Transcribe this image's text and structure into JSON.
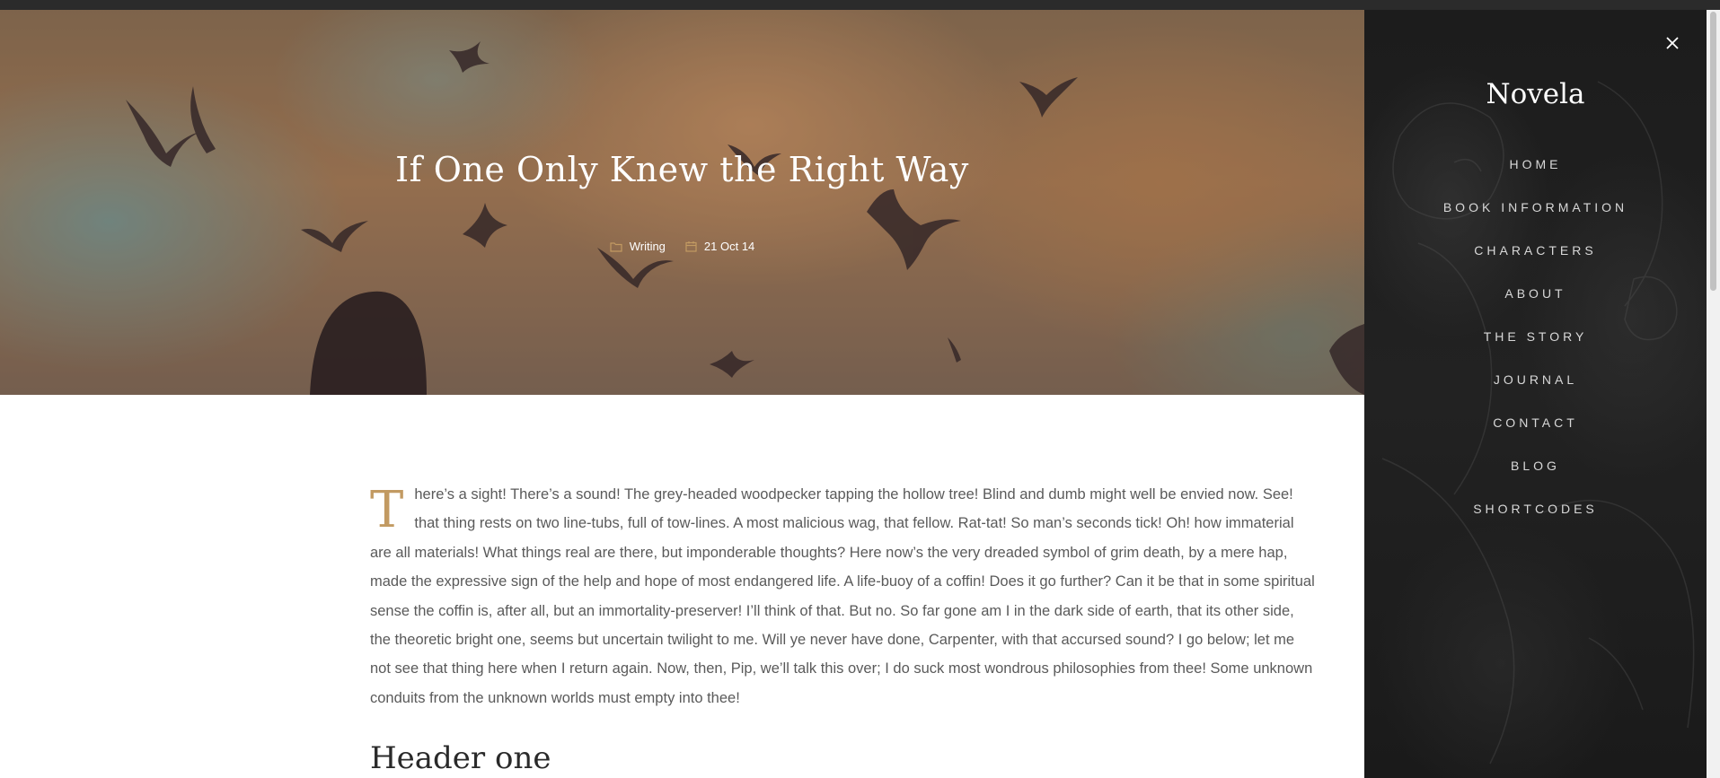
{
  "post": {
    "title": "If One Only Knew the Right Way",
    "category": "Writing",
    "date": "21 Oct 14",
    "dropcap": "T",
    "body": "here’s a sight! There’s a sound! The grey-headed woodpecker tapping the hollow tree! Blind and dumb might well be envied now. See! that thing rests on two line-tubs, full of tow-lines. A most malicious wag, that fellow. Rat-tat! So man’s seconds tick! Oh! how immaterial are all materials! What things real are there, but imponderable thoughts? Here now’s the very dreaded symbol of grim death, by a mere hap, made the expressive sign of the help and hope of most endangered life. A life-buoy of a coffin! Does it go further? Can it be that in some spiritual sense the coffin is, after all, but an immortality-preserver! I’ll think of that. But no. So far gone am I in the dark side of earth, that its other side, the theoretic bright one, seems but uncertain twilight to me. Will ye never have done, Carpenter, with that accursed sound? I go below; let me not see that thing here when I return again. Now, then, Pip, we’ll talk this over; I do suck most wondrous philosophies from thee! Some unknown conduits from the unknown worlds must empty into thee!",
    "heading": "Header one"
  },
  "menu": {
    "brand": "Novela",
    "items": [
      {
        "label": "HOME"
      },
      {
        "label": "BOOK INFORMATION"
      },
      {
        "label": "CHARACTERS"
      },
      {
        "label": "ABOUT"
      },
      {
        "label": "THE STORY"
      },
      {
        "label": "JOURNAL"
      },
      {
        "label": "CONTACT"
      },
      {
        "label": "BLOG"
      },
      {
        "label": "SHORTCODES"
      }
    ]
  },
  "icons": {
    "close": "close-icon",
    "category": "folder-icon",
    "date": "calendar-icon"
  },
  "colors": {
    "accent": "#c29a62",
    "sidebar_bg": "#1e1e1e",
    "body_text": "#5a5a5a"
  }
}
